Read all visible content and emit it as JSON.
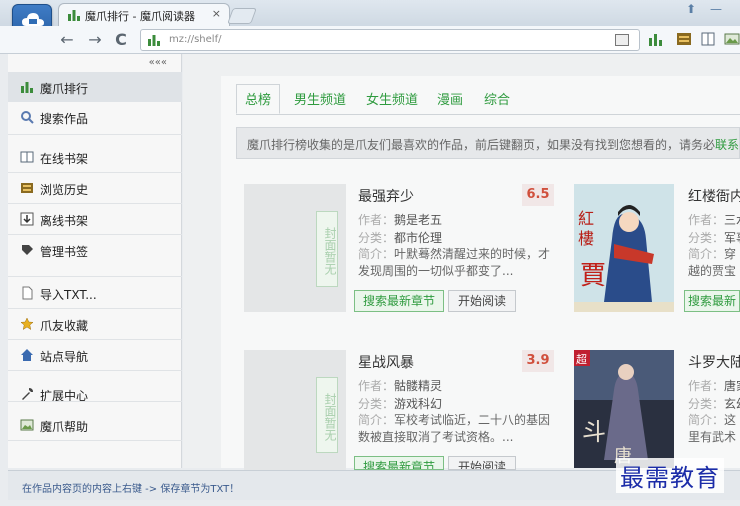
{
  "window": {
    "tab_title": "魔爪排行 - 魔爪阅读器",
    "tab_close": "×",
    "controls": [
      "⬆",
      "—"
    ]
  },
  "toolbar": {
    "back": "←",
    "forward": "→",
    "reload": "C",
    "url": "mz://shelf/"
  },
  "sidebar": {
    "collapse": "«««",
    "items": [
      {
        "label": "魔爪排行",
        "icon": "bar-chart-icon",
        "active": true
      },
      {
        "label": "搜索作品",
        "icon": "search-icon"
      },
      {
        "label": "在线书架",
        "icon": "book-icon"
      },
      {
        "label": "浏览历史",
        "icon": "history-icon"
      },
      {
        "label": "离线书架",
        "icon": "download-icon"
      },
      {
        "label": "管理书签",
        "icon": "bookmark-icon"
      },
      {
        "label": "导入TXT...",
        "icon": "file-icon"
      },
      {
        "label": "爪友收藏",
        "icon": "star-icon"
      },
      {
        "label": "站点导航",
        "icon": "home-icon"
      },
      {
        "label": "扩展中心",
        "icon": "wrench-icon"
      },
      {
        "label": "魔爪帮助",
        "icon": "help-image-icon"
      }
    ]
  },
  "content_tabs": [
    "总榜",
    "男生频道",
    "女生频道",
    "漫画",
    "综合"
  ],
  "notice": {
    "text": "魔爪排行榜收集的是爪友们最喜欢的作品，前后键翻页，如果没有找到您想看的，请务必",
    "highlight": "联系"
  },
  "books": [
    {
      "title": "最强弃少",
      "score": "6.5",
      "author_label": "作者：",
      "author": "鹅是老五",
      "category_label": "分类：",
      "category": "都市伦理",
      "desc_label": "简介：",
      "desc": "叶默蓦然清醒过来的时候，才发现周围的一切似乎都变了...",
      "cover_placeholder": "封面暂无",
      "btn_search": "搜索最新章节",
      "btn_read": "开始阅读"
    },
    {
      "title": "红楼衙内",
      "score": "",
      "author_label": "作者：",
      "author": "三水",
      "category_label": "分类：",
      "category": "军事",
      "desc_label": "简介：",
      "desc": "穿越的贾宝玉...",
      "cover_placeholder": "",
      "btn_search": "搜索最新",
      "btn_read": ""
    },
    {
      "title": "星战风暴",
      "score": "3.9",
      "author_label": "作者：",
      "author": "骷髅精灵",
      "category_label": "分类：",
      "category": "游戏科幻",
      "desc_label": "简介：",
      "desc": "军校考试临近，二十八的基因数被直接取消了考试资格。...",
      "cover_placeholder": "封面暂无",
      "btn_search": "搜索最新章节",
      "btn_read": "开始阅读"
    },
    {
      "title": "斗罗大陆",
      "score": "",
      "author_label": "作者：",
      "author": "唐家",
      "category_label": "分类：",
      "category": "玄幻",
      "desc_label": "简介：",
      "desc": "这里有武术",
      "cover_placeholder": "",
      "btn_search": "",
      "btn_read": ""
    }
  ],
  "status": {
    "text": "在作品内容页的内容上右键 -> 保存章节为TXT！"
  },
  "watermark": "最需教育",
  "colors": {
    "accent_green": "#2f9b3f",
    "score_red": "#d0503d",
    "app_blue": "#2f6db5"
  }
}
